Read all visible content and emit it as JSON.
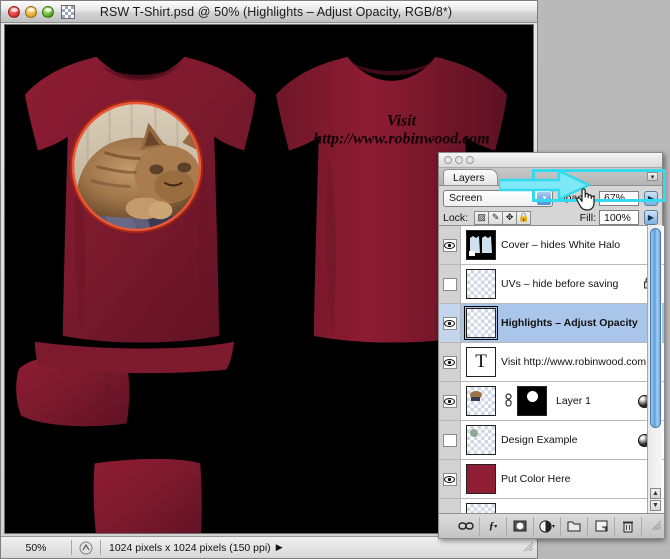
{
  "document_window": {
    "title": "RSW T-Shirt.psd @ 50% (Highlights – Adjust Opacity, RGB/8*)",
    "proxy_icon": "psd-document-icon",
    "traffic_lights": [
      {
        "name": "close-button",
        "color": "#d4292a"
      },
      {
        "name": "minimize-button",
        "color": "#e0a01c"
      },
      {
        "name": "zoom-button",
        "color": "#4aa018"
      }
    ],
    "canvas": {
      "background": "#000000",
      "shirt_color": "#8f1d33",
      "back_print_line1": "Visit",
      "back_print_line2": "http://www.robinwood.com",
      "photo_subject": "tabby-cat-photo",
      "photo_ring_color": "#c8301b"
    },
    "status_bar": {
      "zoom": "50%",
      "proxy_icon": "document-proxy-icon",
      "doc_size": "1024 pixels x 1024 pixels (150 ppi)",
      "arrow": "▶",
      "resize_grip": "resize-grip"
    }
  },
  "layers_palette": {
    "tab_label": "Layers",
    "menu_button": "▾",
    "blend_mode": {
      "label": "blend-mode",
      "value": "Screen",
      "arrow": "▾"
    },
    "opacity": {
      "label": "Opacity:",
      "value": "67%",
      "arrow": "▶"
    },
    "fill": {
      "label": "Fill:",
      "value": "100%",
      "arrow": "▶"
    },
    "lock": {
      "label": "Lock:",
      "buttons": [
        {
          "name": "lock-transparency",
          "glyph": "▨"
        },
        {
          "name": "lock-image-pixels",
          "glyph": "✎"
        },
        {
          "name": "lock-position",
          "glyph": "✥"
        },
        {
          "name": "lock-all",
          "glyph": "🔒"
        }
      ]
    },
    "layers": [
      {
        "name": "Cover – hides White Halo",
        "visible": true,
        "selected": false,
        "thumb_type": "shirt-cover",
        "locked": false,
        "has_effects": false,
        "has_mask": false,
        "linked": false
      },
      {
        "name": "UVs – hide before saving",
        "visible": false,
        "selected": false,
        "thumb_type": "transparent",
        "locked": true,
        "lock_glyph": "🔒",
        "has_effects": false,
        "has_mask": false,
        "linked": false
      },
      {
        "name": "Highlights – Adjust Opacity",
        "visible": true,
        "selected": true,
        "thumb_type": "transparent",
        "locked": false,
        "has_effects": false,
        "has_mask": false,
        "linked": false
      },
      {
        "name": "Visit http://www.robinwood.com",
        "visible": true,
        "selected": false,
        "thumb_type": "text",
        "thumb_glyph": "T",
        "locked": false,
        "has_effects": false,
        "has_mask": false,
        "linked": false
      },
      {
        "name": "Layer 1",
        "visible": true,
        "selected": false,
        "thumb_type": "photo",
        "locked": false,
        "has_effects": true,
        "has_mask": true,
        "linked": true,
        "link_glyph": "🔗"
      },
      {
        "name": "Design Example",
        "visible": false,
        "selected": false,
        "thumb_type": "transparent-dot",
        "locked": false,
        "has_effects": true,
        "has_mask": false,
        "linked": false
      },
      {
        "name": "Put Color Here",
        "visible": true,
        "selected": false,
        "thumb_type": "solid-color",
        "thumb_color": "#8f1d33",
        "locked": false,
        "has_effects": false,
        "has_mask": false,
        "linked": false
      }
    ],
    "scrollbar": {
      "up_arrow": "▲",
      "down_arrow": "▼"
    },
    "toolbar_buttons": [
      {
        "name": "link-layers-button",
        "glyph": "⚭"
      },
      {
        "name": "add-layer-style-button",
        "glyph": "ƒ"
      },
      {
        "name": "add-layer-mask-button",
        "glyph": "◐"
      },
      {
        "name": "new-adjustment-layer-button",
        "glyph": "◑"
      },
      {
        "name": "new-group-button",
        "glyph": "▭"
      },
      {
        "name": "new-layer-button",
        "glyph": "◲"
      },
      {
        "name": "delete-layer-button",
        "glyph": "🗑"
      }
    ],
    "resize_grip": "resize-grip"
  },
  "annotation": {
    "highlight_color": "#32d9ef",
    "target": "opacity-field",
    "cursor": "pointing-hand-cursor"
  }
}
